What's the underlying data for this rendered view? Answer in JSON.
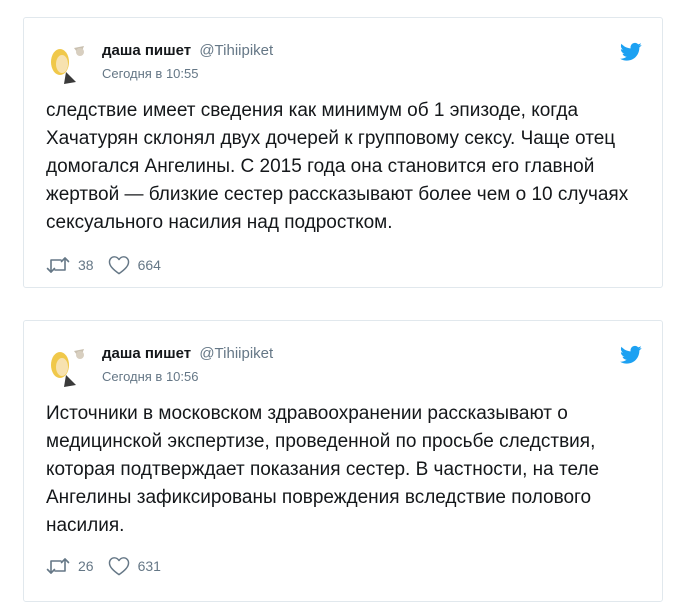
{
  "colors": {
    "accent": "#1da1f2",
    "text": "#14171a",
    "muted": "#657786",
    "border": "#e1e8ed"
  },
  "tweets": [
    {
      "name": "даша пишет",
      "handle": "@Tihiipiket",
      "time": "Сегодня в 10:55",
      "text": "следствие имеет сведения как минимум об 1 эпизоде, когда Хачатурян склонял двух дочерей к групповому сексу. Чаще отец домогался Ангелины. С 2015 года она становится его главной жертвой — близкие сестер рассказывают более чем о 10 случаях сексуального насилия над подростком.",
      "retweets": "38",
      "likes": "664",
      "icons": [
        "avatar",
        "twitter-bird-icon",
        "retweet-icon",
        "heart-icon"
      ]
    },
    {
      "name": "даша пишет",
      "handle": "@Tihiipiket",
      "time": "Сегодня в 10:56",
      "text": "Источники в московском здравоохранении рассказывают о медицинской экспертизе, проведенной по просьбе следствия, которая подтверждает показания сестер. В частности, на теле Ангелины зафиксированы повреждения вследствие полового насилия.",
      "retweets": "26",
      "likes": "631",
      "icons": [
        "avatar",
        "twitter-bird-icon",
        "retweet-icon",
        "heart-icon"
      ]
    }
  ]
}
